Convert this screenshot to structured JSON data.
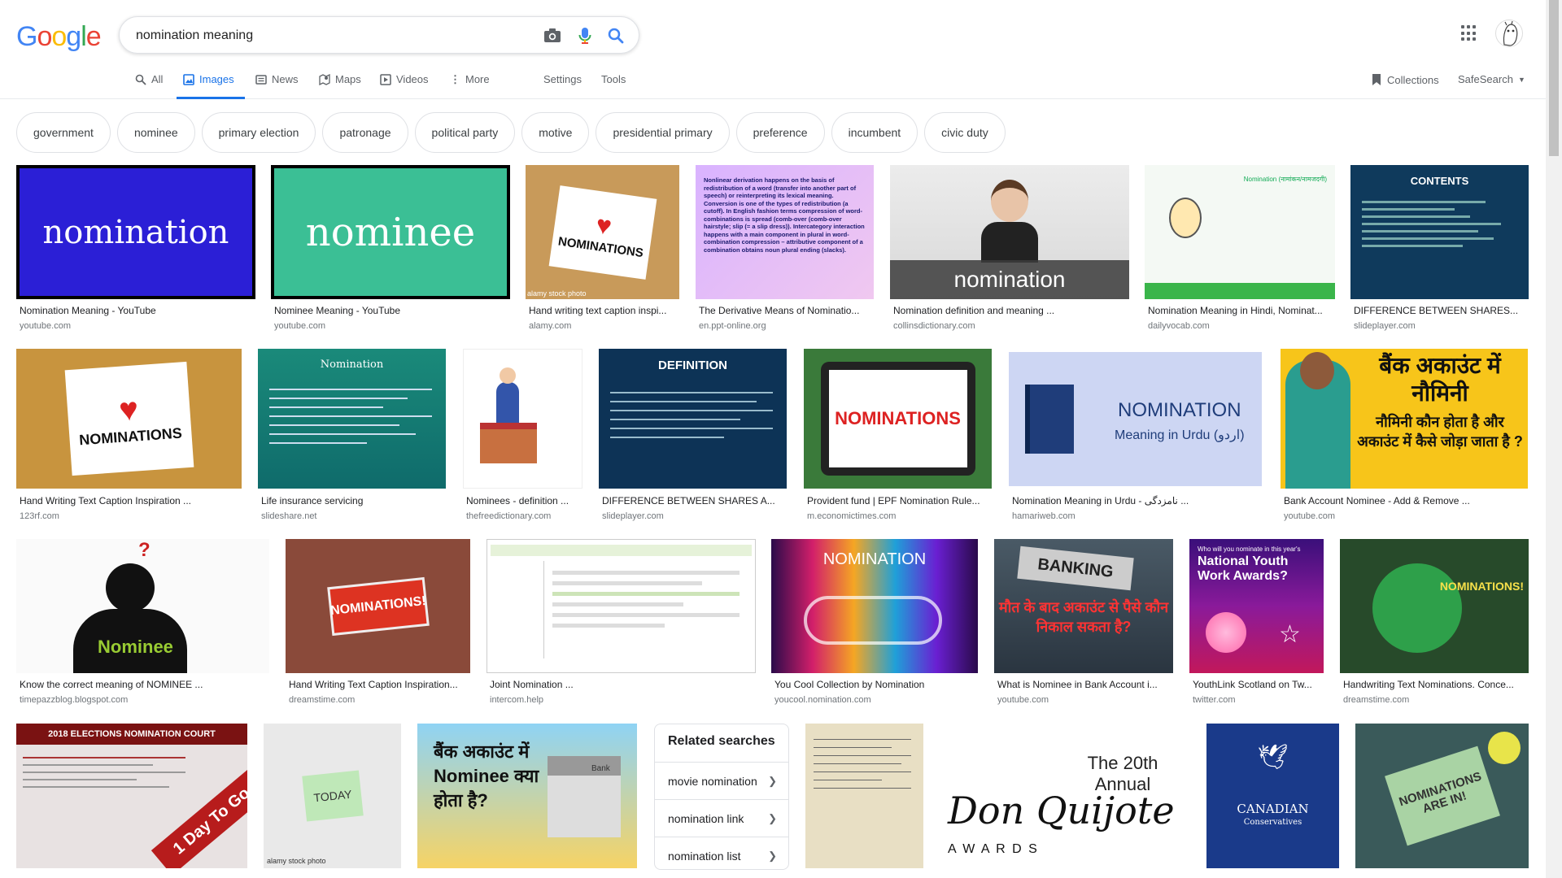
{
  "header": {
    "logo": [
      "G",
      "o",
      "o",
      "g",
      "l",
      "e"
    ],
    "logo_colors": [
      "#4285f4",
      "#ea4335",
      "#fbbc05",
      "#4285f4",
      "#34a853",
      "#ea4335"
    ],
    "search_value": "nomination meaning"
  },
  "tabs": {
    "all": "All",
    "images": "Images",
    "news": "News",
    "maps": "Maps",
    "videos": "Videos",
    "more": "More",
    "settings": "Settings",
    "tools": "Tools",
    "collections": "Collections",
    "safesearch": "SafeSearch"
  },
  "chips": [
    "government",
    "nominee",
    "primary election",
    "patronage",
    "political party",
    "motive",
    "presidential primary",
    "preference",
    "incumbent",
    "civic duty"
  ],
  "results": [
    {
      "caption": "Nomination Meaning - YouTube",
      "source": "youtube.com",
      "thumb_text": "nomination"
    },
    {
      "caption": "Nominee Meaning - YouTube",
      "source": "youtube.com",
      "thumb_text": "nominee"
    },
    {
      "caption": "Hand writing text caption inspi...",
      "source": "alamy.com",
      "thumb_text": "NOMINATIONS",
      "thumb_sub": "alamy stock photo"
    },
    {
      "caption": "The Derivative Means of Nominatio...",
      "source": "en.ppt-online.org",
      "thumb_text": "Nonlinear derivation happens on the basis of redistribution of a word (transfer into another part of speech) or reinterpreting its lexical meaning. Conversion is one of the types of redistribution (a cutoff). In English fashion terms compression of word-combinations is spread (comb-over (comb-over hairstyle; slip (= a slip dress)). Intercategory interaction happens with a main component in plural in word-combination compression – attributive component of a combination obtains noun plural ending (slacks)."
    },
    {
      "caption": "Nomination definition and meaning ...",
      "source": "collinsdictionary.com",
      "thumb_text": "nomination"
    },
    {
      "caption": "Nomination Meaning in Hindi, Nominat...",
      "source": "dailyvocab.com",
      "thumb_text": "Nomination (नामांकन/नामजदगी)"
    },
    {
      "caption": "DIFFERENCE BETWEEN SHARES...",
      "source": "slideplayer.com",
      "thumb_text": "CONTENTS"
    },
    {
      "caption": "Hand Writing Text Caption Inspiration ...",
      "source": "123rf.com",
      "thumb_text": "NOMINATIONS"
    },
    {
      "caption": "Life insurance servicing",
      "source": "slideshare.net",
      "thumb_text": "Nomination"
    },
    {
      "caption": "Nominees - definition ...",
      "source": "thefreedictionary.com"
    },
    {
      "caption": "DIFFERENCE BETWEEN SHARES A...",
      "source": "slideplayer.com",
      "thumb_text": "DEFINITION"
    },
    {
      "caption": "Provident fund | EPF Nomination Rule...",
      "source": "m.economictimes.com",
      "thumb_text": "NOMINATIONS"
    },
    {
      "caption": "Nomination Meaning in Urdu - نامزدگی ...",
      "source": "hamariweb.com",
      "thumb_text": "NOMINATION",
      "thumb_sub": "Meaning in Urdu (اردو)"
    },
    {
      "caption": "Bank Account Nominee - Add & Remove ...",
      "source": "youtube.com",
      "thumb_text": "बैंक अकाउंट में नौमिनी",
      "thumb_sub": "नौमिनी कौन होता है और अकाउंट में कैसे जोड़ा जाता है ?"
    },
    {
      "caption": "Know the correct meaning of NOMINEE ...",
      "source": "timepazzblog.blogspot.com",
      "thumb_text": "Nominee"
    },
    {
      "caption": "Hand Writing Text Caption Inspiration...",
      "source": "dreamstime.com",
      "thumb_text": "NOMINATIONS!"
    },
    {
      "caption": "Joint Nomination ...",
      "source": "intercom.help"
    },
    {
      "caption": "You Cool Collection by Nomination",
      "source": "youcool.nomination.com",
      "thumb_text": "NOMINATION"
    },
    {
      "caption": "What is Nominee in Bank Account i...",
      "source": "youtube.com",
      "thumb_text": "BANKING",
      "thumb_sub": "मौत के बाद अकाउंट से पैसे कौन निकाल सकता है?"
    },
    {
      "caption": "YouthLink Scotland on Tw...",
      "source": "twitter.com",
      "thumb_text": "National Youth Work Awards?",
      "thumb_sub": "Who will you nominate in this year's"
    },
    {
      "caption": "Handwriting Text Nominations. Conce...",
      "source": "dreamstime.com",
      "thumb_text": "NOMINATIONS!"
    },
    {
      "thumb_text": "2018 ELECTIONS NOMINATION COURT",
      "thumb_sub": "1 Day To Go"
    },
    {
      "thumb_text": "TODAY",
      "thumb_sub": "alamy stock photo"
    },
    {
      "thumb_text": "बैंक अकाउंट में Nominee क्या होता है?",
      "thumb_sub": "Bank"
    },
    {
      "thumb_text": ""
    },
    {
      "thumb_text": "Don Quijote",
      "thumb_sub": "The 20th Annual",
      "thumb_sub2": "A W A R D S"
    },
    {
      "thumb_text": "CANADIAN",
      "thumb_sub": "Conservatives"
    },
    {
      "thumb_text": "NOMINATIONS ARE IN!"
    }
  ],
  "related": {
    "title": "Related searches",
    "items": [
      "movie nomination",
      "nomination link",
      "nomination list"
    ]
  }
}
